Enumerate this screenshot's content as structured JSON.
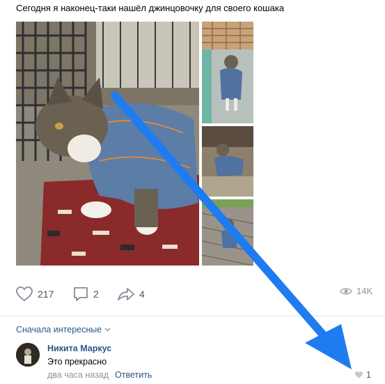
{
  "post": {
    "text": "Сегодня я наконец-таки нашёл джинцовочку для своего кошака"
  },
  "actions": {
    "likes": "217",
    "comments": "2",
    "shares": "4",
    "views": "14K"
  },
  "comments": {
    "sort_label": "Сначала интересные",
    "items": [
      {
        "author": "Никита Маркус",
        "text": "Это прекрасно",
        "time": "два часа назад",
        "reply_label": "Ответить",
        "likes": "1"
      }
    ]
  },
  "icons": {
    "like": "heart-icon",
    "comment": "speech-bubble-icon",
    "share": "share-arrow-icon",
    "views": "eye-icon",
    "sort": "chevron-down-icon",
    "comment_like": "heart-filled-icon"
  },
  "colors": {
    "link": "#2a5885",
    "muted": "#939393",
    "annotation_arrow": "#1f7cf0"
  }
}
